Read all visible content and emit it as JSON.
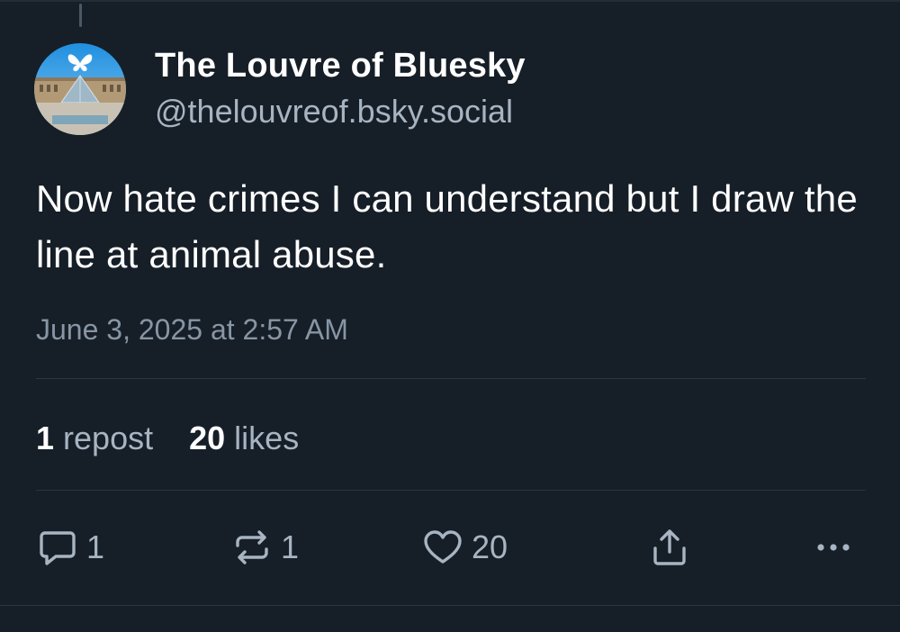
{
  "author": {
    "display_name": "The Louvre of Bluesky",
    "handle": "@thelouvreof.bsky.social",
    "avatar_icon": "louvre-butterfly-avatar"
  },
  "post": {
    "text": "Now hate crimes I can understand but I draw the line at animal abuse.",
    "timestamp": "June 3, 2025 at 2:57 AM"
  },
  "stats": {
    "reposts_count": "1",
    "reposts_label": "repost",
    "likes_count": "20",
    "likes_label": "likes"
  },
  "actions": {
    "reply_count": "1",
    "repost_count": "1",
    "like_count": "20",
    "reply_icon": "reply-icon",
    "repost_icon": "repost-icon",
    "like_icon": "heart-icon",
    "share_icon": "share-icon",
    "more_icon": "more-options-icon"
  },
  "colors": {
    "background": "#161e27",
    "text_primary": "#ffffff",
    "text_secondary": "#a7b4c2",
    "timestamp": "#8795a4",
    "divider": "#2b3541"
  }
}
